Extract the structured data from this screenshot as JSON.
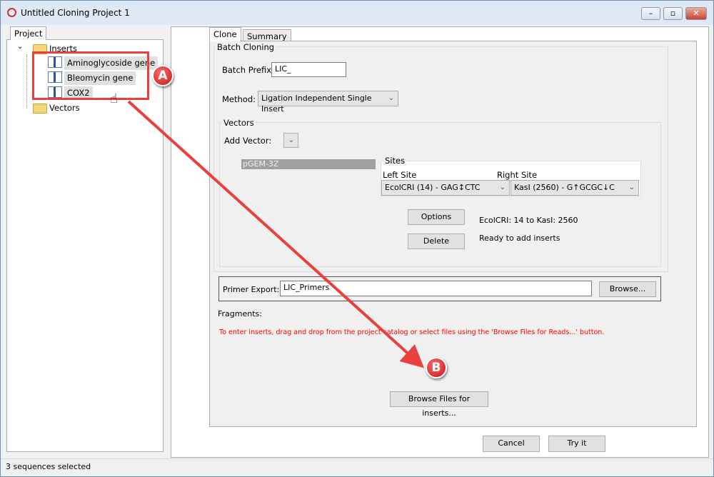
{
  "window": {
    "title": "Untitled Cloning Project 1",
    "controls": [
      "minimize",
      "maximize",
      "close"
    ]
  },
  "project": {
    "tab": "Project",
    "tree": [
      {
        "label": "Inserts",
        "icon": "folder-icon",
        "children": [
          "Aminoglycoside gene",
          "Bleomycin gene",
          "COX2"
        ]
      },
      {
        "label": "Vectors",
        "icon": "folder-icon"
      }
    ]
  },
  "tabs": [
    {
      "label": "Clone",
      "active": true
    },
    {
      "label": "Summary",
      "active": false
    }
  ],
  "batch": {
    "group": "Batch Cloning",
    "prefix_label": "Batch Prefix:",
    "prefix_value": "LIC_",
    "method_label": "Method:",
    "method_value": "Ligation Independent Single Insert"
  },
  "vectors": {
    "group": "Vectors",
    "add_label": "Add Vector:",
    "selected": "pGEM-3Z",
    "sites_group": "Sites",
    "left_label": "Left Site",
    "left_value": "EcolCRI (14) - GAG↕CTC",
    "right_label": "Right Site",
    "right_value": "KasI (2560) - G↑GCGC↓C",
    "options": "Options",
    "delete": "Delete",
    "range_text": "EcolCRI: 14 to KasI: 2560",
    "status_text": "Ready to add inserts"
  },
  "primer": {
    "label": "Primer Export:",
    "value": "LIC_Primers",
    "browse": "Browse..."
  },
  "fragments": {
    "label": "Fragments:",
    "hint": "To enter inserts, drag and drop from the project catalog or select files using the 'Browse Files for Reads...' button.",
    "hint_color": "#ff0000",
    "browse": "Browse Files for inserts..."
  },
  "footer": {
    "cancel": "Cancel",
    "try": "Try it"
  },
  "status": "3 sequences selected",
  "annotations": {
    "a": "A",
    "b": "B",
    "color": "#e8403c"
  }
}
